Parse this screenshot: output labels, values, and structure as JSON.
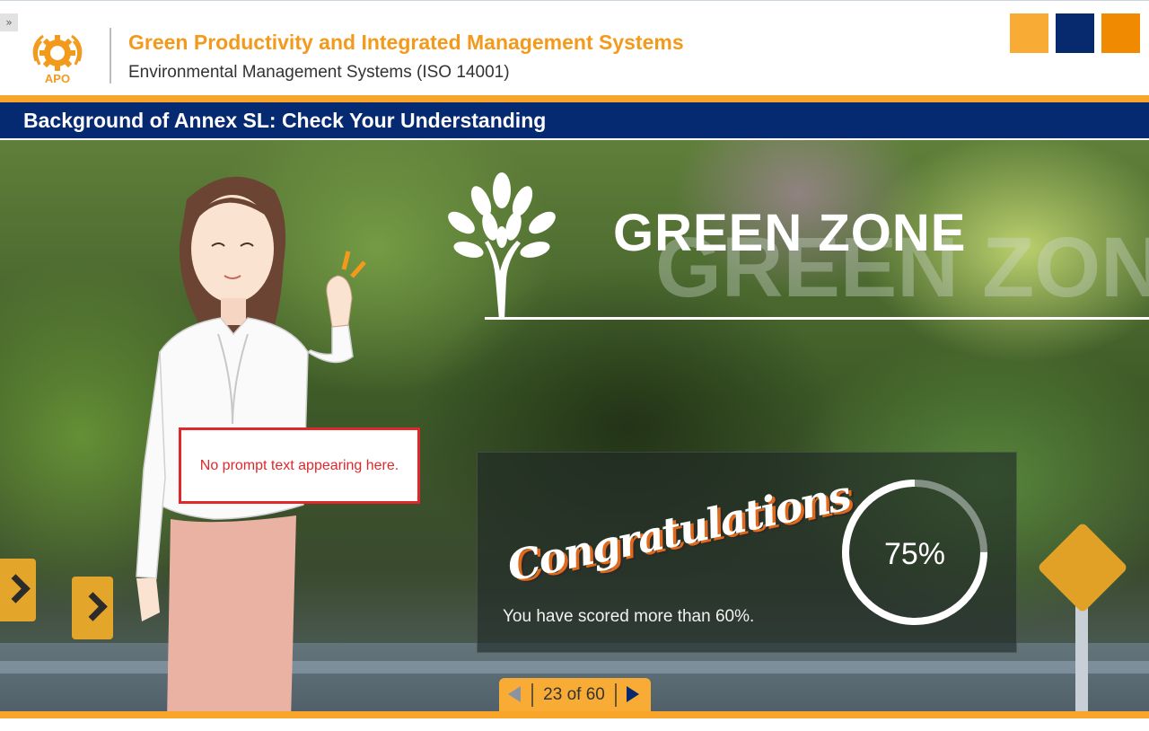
{
  "header": {
    "expand_glyph": "»",
    "logo_text": "APO",
    "course_title": "Green Productivity and Integrated Management Systems",
    "course_subtitle": "Environmental Management Systems (ISO 14001)",
    "color_buttons": [
      "#f8ac35",
      "#07296e",
      "#f08a00"
    ]
  },
  "slide": {
    "title": "Background of Annex SL: Check Your Understanding",
    "zone_title": "GREEN ZONE",
    "zone_title_ghost": "GREEN ZONE",
    "tree_icon": "tree-icon"
  },
  "result": {
    "congratulations": "Congratulations",
    "message": "You have scored more than 60%.",
    "score_label": "75%",
    "score_fraction": 0.75
  },
  "prompt": {
    "text": "No prompt text appearing here."
  },
  "navigation": {
    "counter": "23 of 60",
    "prev_icon": "prev-arrow-icon",
    "next_icon": "next-arrow-icon"
  },
  "colors": {
    "accent_orange": "#f8a52a",
    "title_navy": "#062a72",
    "prompt_red": "#e0282b"
  }
}
